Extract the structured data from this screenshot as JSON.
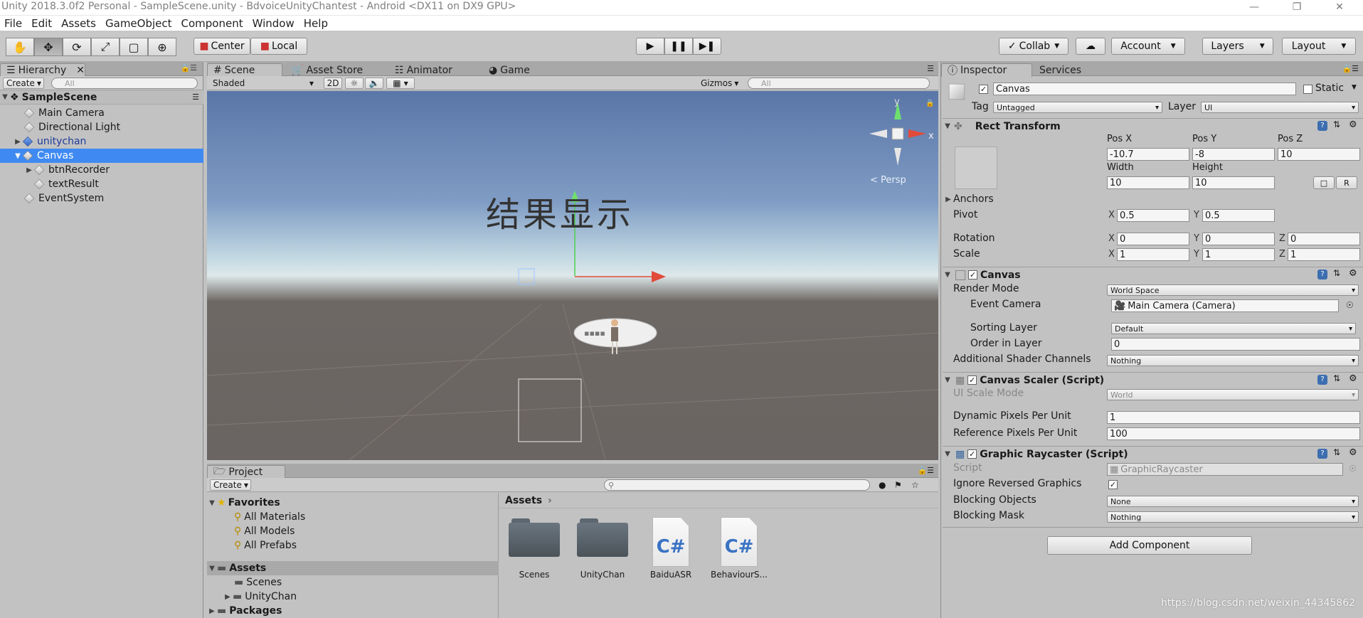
{
  "window": {
    "title": "Unity 2018.3.0f2 Personal - SampleScene.unity - BdvoiceUnityChantest - Android <DX11 on DX9 GPU>"
  },
  "menu": [
    "File",
    "Edit",
    "Assets",
    "GameObject",
    "Component",
    "Window",
    "Help"
  ],
  "toolbar": {
    "tools": [
      "hand-icon",
      "move-icon",
      "rotate-icon",
      "scale-icon",
      "rect-icon",
      "transform-icon"
    ],
    "pivot_center": "Center",
    "pivot_local": "Local",
    "collab": "Collab",
    "account": "Account",
    "layers": "Layers",
    "layout": "Layout"
  },
  "hierarchy": {
    "tab": "Hierarchy",
    "create": "Create",
    "search_placeholder": "All",
    "scene": "SampleScene",
    "items": [
      {
        "label": "Main Camera"
      },
      {
        "label": "Directional Light"
      },
      {
        "label": "unitychan"
      },
      {
        "label": "Canvas"
      },
      {
        "label": "btnRecorder"
      },
      {
        "label": "textResult"
      },
      {
        "label": "EventSystem"
      }
    ]
  },
  "scene": {
    "tabs": [
      "Scene",
      "Asset Store",
      "Animator",
      "Game"
    ],
    "shading": "Shaded",
    "mode2d": "2D",
    "gizmos": "Gizmos",
    "search_placeholder": "All",
    "persp": "Persp",
    "overlay_text": "结果显示",
    "gizmo_y": "y",
    "gizmo_x": "x"
  },
  "project": {
    "tab": "Project",
    "create": "Create",
    "favorites": "Favorites",
    "fav_items": [
      "All Materials",
      "All Models",
      "All Prefabs"
    ],
    "assets_root": "Assets",
    "asset_children": [
      "Scenes",
      "UnityChan"
    ],
    "packages": "Packages",
    "breadcrumb": "Assets",
    "grid": [
      {
        "name": "Scenes",
        "type": "folder"
      },
      {
        "name": "UnityChan",
        "type": "folder"
      },
      {
        "name": "BaiduASR",
        "type": "cs"
      },
      {
        "name": "BehaviourS...",
        "type": "cs"
      }
    ],
    "cs_glyph": "C#"
  },
  "inspector": {
    "tabs": [
      "Inspector",
      "Services"
    ],
    "object_name": "Canvas",
    "static_label": "Static",
    "tag_label": "Tag",
    "tag_value": "Untagged",
    "layer_label": "Layer",
    "layer_value": "UI",
    "rect": {
      "title": "Rect Transform",
      "posx_label": "Pos X",
      "posy_label": "Pos Y",
      "posz_label": "Pos Z",
      "posx": "-10.7",
      "posy": "-8",
      "posz": "10",
      "width_label": "Width",
      "height_label": "Height",
      "width": "10",
      "height": "10",
      "r_btn": "R",
      "anchors": "Anchors",
      "pivot": "Pivot",
      "pivot_x": "0.5",
      "pivot_y": "0.5",
      "rotation": "Rotation",
      "rot_x": "0",
      "rot_y": "0",
      "rot_z": "0",
      "scale": "Scale",
      "scale_x": "1",
      "scale_y": "1",
      "scale_z": "1",
      "x": "X",
      "y": "Y",
      "z": "Z"
    },
    "canvas": {
      "title": "Canvas",
      "render_mode": "Render Mode",
      "render_mode_value": "World Space",
      "event_camera": "Event Camera",
      "event_camera_value": "Main Camera (Camera)",
      "sorting_layer": "Sorting Layer",
      "sorting_layer_value": "Default",
      "order": "Order in Layer",
      "order_value": "0",
      "shader_channels": "Additional Shader Channels",
      "shader_channels_value": "Nothing"
    },
    "scaler": {
      "title": "Canvas Scaler (Script)",
      "ui_scale": "UI Scale Mode",
      "ui_scale_value": "World",
      "dppu": "Dynamic Pixels Per Unit",
      "dppu_value": "1",
      "rppu": "Reference Pixels Per Unit",
      "rppu_value": "100"
    },
    "raycaster": {
      "title": "Graphic Raycaster (Script)",
      "script": "Script",
      "script_value": "GraphicRaycaster",
      "ignore_reversed": "Ignore Reversed Graphics",
      "blocking_objects": "Blocking Objects",
      "blocking_objects_value": "None",
      "blocking_mask": "Blocking Mask",
      "blocking_mask_value": "Nothing"
    },
    "add_component": "Add Component"
  },
  "watermark": "https://blog.csdn.net/weixin_44345862"
}
